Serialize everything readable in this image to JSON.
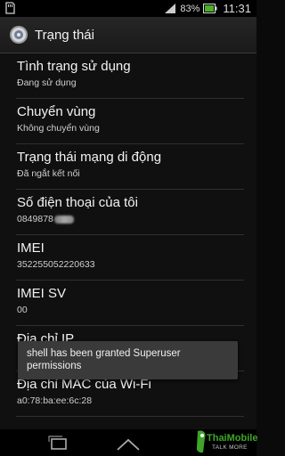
{
  "status_bar": {
    "battery_percent": "83%",
    "time": "11:31",
    "notification_icon": "sd-card-icon",
    "signal_icon": "signal-icon",
    "battery_icon": "battery-icon"
  },
  "action_bar": {
    "title": "Trạng thái",
    "icon": "settings-app-icon"
  },
  "items": [
    {
      "label": "Tình trạng sử dụng",
      "value": "Đang sử dụng"
    },
    {
      "label": "Chuyển vùng",
      "value": "Không chuyển vùng"
    },
    {
      "label": "Trạng thái mạng di động",
      "value": "Đã ngắt kết nối"
    },
    {
      "label": "Số điện thoại của tôi",
      "value": "0849878"
    },
    {
      "label": "IMEI",
      "value": "352255052220633"
    },
    {
      "label": "IMEI SV",
      "value": "00"
    },
    {
      "label": "Địa chỉ IP",
      "value": ""
    },
    {
      "label": "Địa chỉ MAC của Wi-Fi",
      "value": "a0:78:ba:ee:6c:28"
    }
  ],
  "toast": {
    "text": "shell has been granted Superuser permissions"
  },
  "nav_bar": {
    "recent_icon": "recent-apps-icon",
    "home_icon": "home-icon"
  },
  "watermark": {
    "brand": "ThaiMobile",
    "tagline": "TALK MORE"
  },
  "colors": {
    "background": "#101010",
    "battery_green": "#4caf2a",
    "divider": "#2f2f2f"
  }
}
